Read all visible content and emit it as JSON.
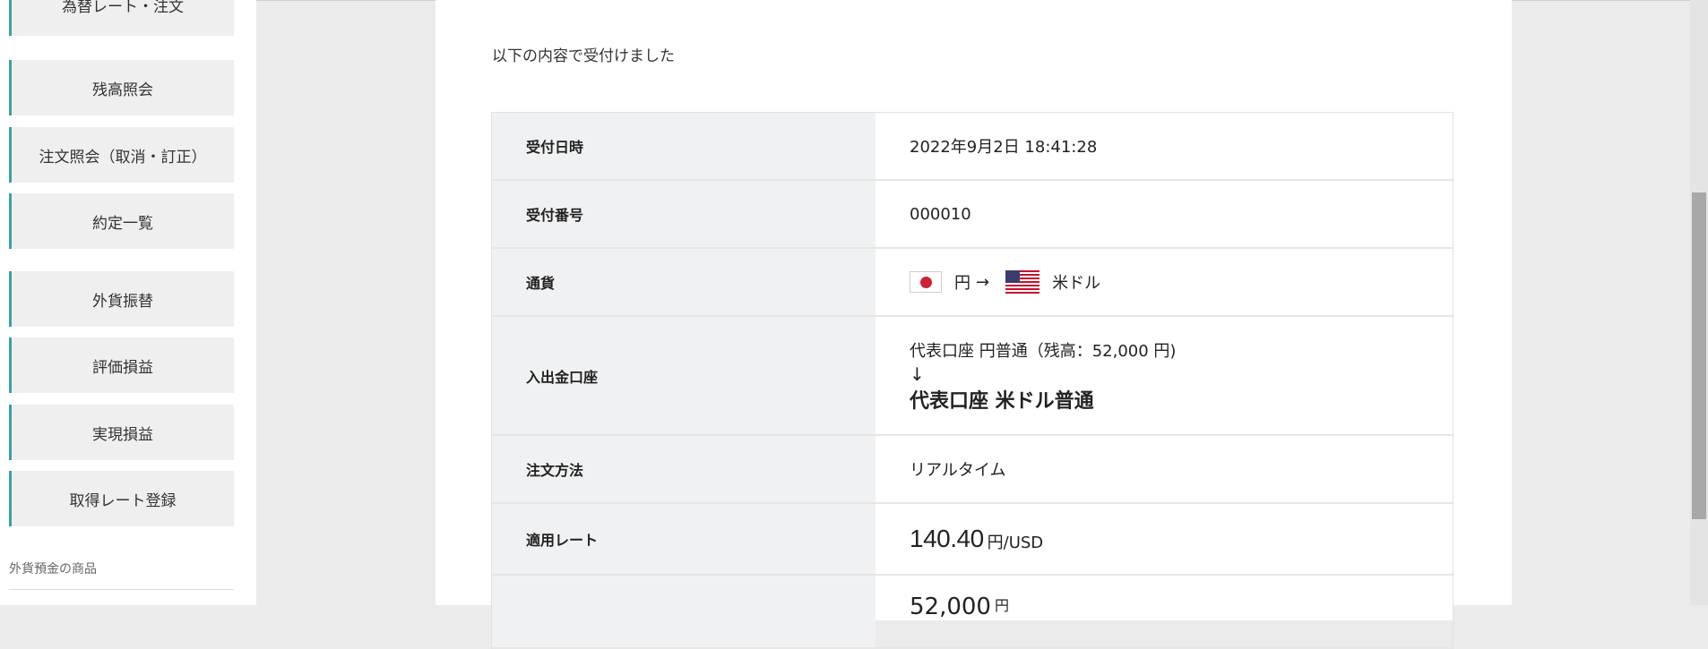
{
  "sidebar": {
    "items": [
      {
        "label": "為替レート・注文"
      },
      {
        "label": "残高照会"
      },
      {
        "label": "注文照会（取消・訂正）"
      },
      {
        "label": "約定一覧"
      },
      {
        "label": "外貨振替"
      },
      {
        "label": "評価損益"
      },
      {
        "label": "実現損益"
      },
      {
        "label": "取得レート登録"
      }
    ],
    "section_label": "外貨預金の商品"
  },
  "main": {
    "intro": "以下の内容で受付けました",
    "rows": {
      "received_at": {
        "label": "受付日時",
        "value": "2022年9月2日 18:41:28"
      },
      "receipt_no": {
        "label": "受付番号",
        "value": "000010"
      },
      "currency": {
        "label": "通貨",
        "from": "円",
        "arrow": "→",
        "to": "米ドル"
      },
      "account": {
        "label": "入出金口座",
        "from": "代表口座 円普通（残高：52,000 円)",
        "arrow": "↓",
        "to": "代表口座 米ドル普通"
      },
      "method": {
        "label": "注文方法",
        "value": "リアルタイム"
      },
      "rate": {
        "label": "適用レート",
        "value": "140.40",
        "unit": "円/USD"
      },
      "amount": {
        "value": "52,000",
        "unit": "円"
      }
    }
  },
  "icons": {
    "from_flag": "japan-flag-icon",
    "to_flag": "us-flag-icon"
  },
  "colors": {
    "accent": "#3aa0a3",
    "header_bg": "#f0f1f2",
    "page_bg": "#ebebeb"
  }
}
